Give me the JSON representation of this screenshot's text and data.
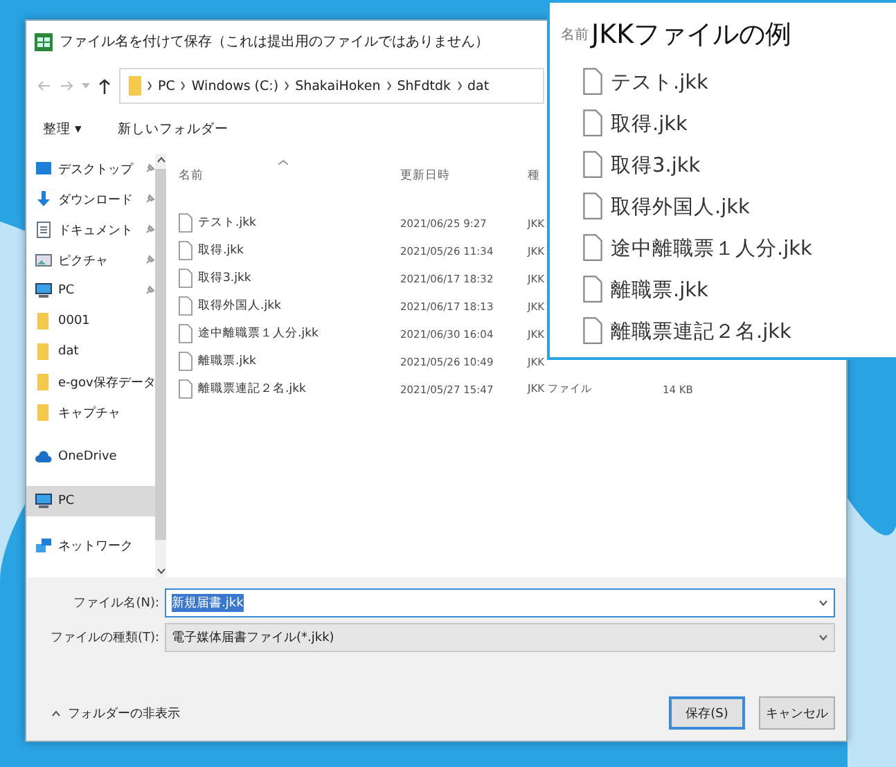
{
  "window": {
    "title": "ファイル名を付けて保存（これは提出用のファイルではありません）"
  },
  "address_bar": {
    "path": [
      "PC",
      "Windows (C:)",
      "ShakaiHoken",
      "ShFdtdk",
      "dat"
    ]
  },
  "toolbar": {
    "organize": "整理 ▾",
    "new_folder": "新しいフォルダー"
  },
  "sidebar": {
    "items": [
      {
        "label": "デスクトップ",
        "kind": "desktop",
        "pinned": true,
        "selected": false
      },
      {
        "label": "ダウンロード",
        "kind": "download",
        "pinned": true,
        "selected": false
      },
      {
        "label": "ドキュメント",
        "kind": "document",
        "pinned": true,
        "selected": false
      },
      {
        "label": "ピクチャ",
        "kind": "picture",
        "pinned": true,
        "selected": false
      },
      {
        "label": "PC",
        "kind": "pc",
        "pinned": true,
        "selected": false
      },
      {
        "label": "0001",
        "kind": "folder",
        "pinned": false,
        "selected": false
      },
      {
        "label": "dat",
        "kind": "folder",
        "pinned": false,
        "selected": false
      },
      {
        "label": "e-gov保存データ",
        "kind": "folder",
        "pinned": false,
        "selected": false
      },
      {
        "label": "キャプチャ",
        "kind": "folder",
        "pinned": false,
        "selected": false
      },
      {
        "label": "OneDrive",
        "kind": "cloud",
        "pinned": false,
        "selected": false
      },
      {
        "label": "PC",
        "kind": "pc",
        "pinned": false,
        "selected": true
      },
      {
        "label": "ネットワーク",
        "kind": "network",
        "pinned": false,
        "selected": false
      }
    ]
  },
  "table": {
    "columns": [
      "名前",
      "更新日時",
      "種"
    ],
    "rows": [
      {
        "name": "テスト.jkk",
        "date": "2021/06/25 9:27",
        "type": "JKK"
      },
      {
        "name": "取得.jkk",
        "date": "2021/05/26 11:34",
        "type": "JKK"
      },
      {
        "name": "取得3.jkk",
        "date": "2021/06/17 18:32",
        "type": "JKK"
      },
      {
        "name": "取得外国人.jkk",
        "date": "2021/06/17 18:13",
        "type": "JKK"
      },
      {
        "name": "途中離職票１人分.jkk",
        "date": "2021/06/30 16:04",
        "type": "JKK"
      },
      {
        "name": "離職票.jkk",
        "date": "2021/05/26 10:49",
        "type": "JKK"
      },
      {
        "name": "離職票連記２名.jkk",
        "date": "2021/05/27 15:47",
        "type": "JKK ファイル",
        "size": "14 KB"
      }
    ]
  },
  "filename": {
    "label": "ファイル名(N):",
    "value": "新規届書.jkk"
  },
  "filetype": {
    "label": "ファイルの種類(T):",
    "value": "電子媒体届書ファイル(*.jkk)"
  },
  "hide_folders": "フォルダーの非表示",
  "buttons": [
    {
      "label": "保存(S)",
      "selected": true
    },
    {
      "label": "キャンセル",
      "selected": false
    }
  ],
  "callout": {
    "header": "名前",
    "title": "JKKファイルの例",
    "files": [
      "テスト.jkk",
      "取得.jkk",
      "取得3.jkk",
      "取得外国人.jkk",
      "途中離職票１人分.jkk",
      "離職票.jkk",
      "離職票連記２名.jkk"
    ]
  }
}
